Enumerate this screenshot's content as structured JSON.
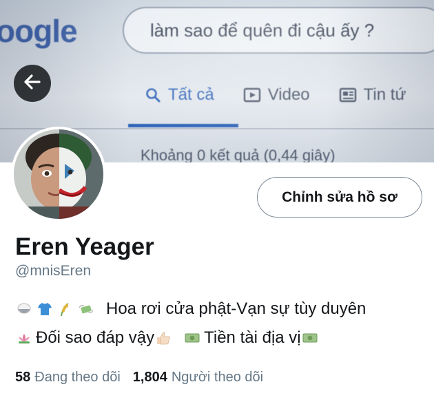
{
  "banner": {
    "logo_text": "oogle",
    "search_query": "làm sao để quên đi cậu ấy ?",
    "tabs": [
      {
        "label": "Tất cả",
        "icon": "search-icon",
        "active": true
      },
      {
        "label": "Video",
        "icon": "video-icon",
        "active": false
      },
      {
        "label": "Tin tứ",
        "icon": "news-icon",
        "active": false
      }
    ],
    "result_stats": "Khoảng 0 kết quả (0,44 giây)"
  },
  "header": {
    "back_icon": "arrow-left-icon"
  },
  "profile": {
    "edit_button_label": "Chỉnh sửa hồ sơ",
    "display_name": "Eren Yeager",
    "handle": "@mnisEren",
    "bio": {
      "line1_text": "Hoa rơi cửa phật-Vạn sự tùy duyên",
      "line2_text_a": "Đối sao đáp vậy",
      "line2_text_b": "Tiền tài địa vị",
      "line1_emojis": [
        "rice-bowl-emoji",
        "tshirt-emoji",
        "rice-plant-emoji",
        "money-wings-emoji"
      ],
      "line2_emojis": [
        "lotus-emoji",
        "thumbs-up-emoji",
        "banknote-emoji",
        "banknote-emoji"
      ]
    },
    "following_count": "58",
    "following_label": "Đang theo dõi",
    "followers_count": "1,804",
    "followers_label": "Người theo dõi"
  },
  "colors": {
    "link_blue": "#2f63b8",
    "muted_text": "#657786",
    "primary_text": "#14171a",
    "button_border": "#7b8794"
  }
}
